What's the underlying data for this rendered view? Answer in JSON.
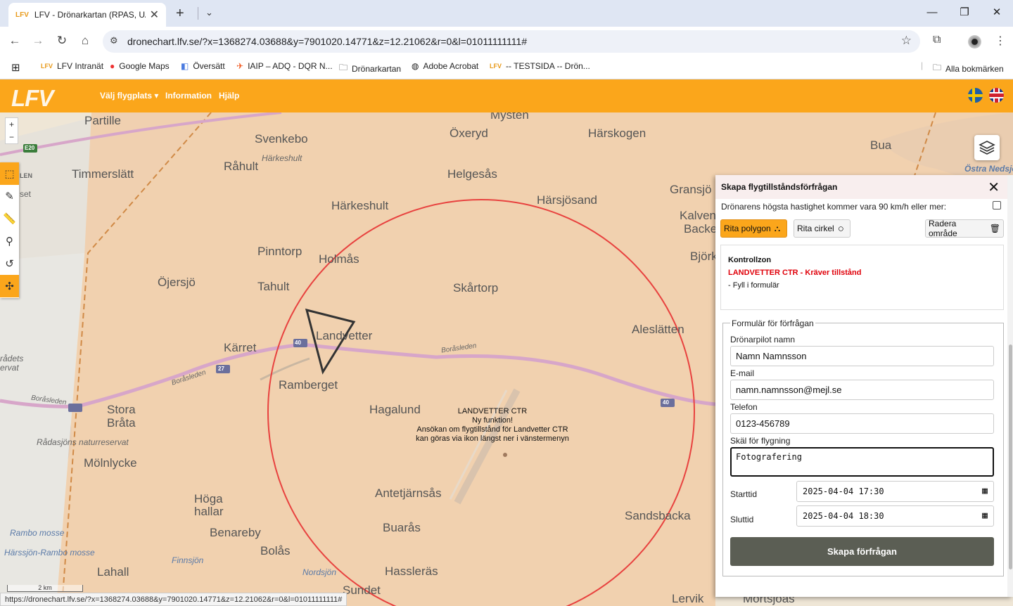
{
  "browser": {
    "tab_title": "LFV - Drönarkartan (RPAS, UAS,",
    "tab_favicon": "LFV",
    "new_tab": "+",
    "url": "dronechart.lfv.se/?x=1368274.03688&y=7901020.14771&z=12.21062&r=0&l=01011111111#",
    "bookmarks": [
      {
        "icon": "LFV",
        "label": "LFV Intranät"
      },
      {
        "icon": "map-pin-icon",
        "label": "Google Maps"
      },
      {
        "icon": "translate-icon",
        "label": "Översätt"
      },
      {
        "icon": "plane-icon",
        "label": "IAIP – ADQ - DQR N..."
      },
      {
        "icon": "folder-icon",
        "label": "Drönarkartan"
      },
      {
        "icon": "globe-icon",
        "label": "Adobe Acrobat"
      },
      {
        "icon": "LFV",
        "label": "-- TESTSIDA -- Drön..."
      }
    ],
    "all_bookmarks": "Alla bokmärken",
    "status_url": "https://dronechart.lfv.se/?x=1368274.03688&y=7901020.14771&z=12.21062&r=0&l=01011111111#"
  },
  "header": {
    "logo": "LFV",
    "menu": [
      "Välj flygplats ▾",
      "Information",
      "Hjälp"
    ]
  },
  "map": {
    "places": [
      "Mysten",
      "Partille",
      "Svenkebo",
      "Öxeryd",
      "Härskogen",
      "Bua",
      "Härkeshult",
      "Råhult",
      "Timmerslätt",
      "Helgesås",
      "Gransjö",
      "Härkeshult",
      "Härsjösand",
      "Kalven",
      "Backe",
      "Pinntorp",
      "Holmås",
      "Björk",
      "Öjersjö",
      "Tahult",
      "Skårtorp",
      "Landvetter",
      "Aleslätten",
      "Kärret",
      "Ramberget",
      "Hagalund",
      "Stora",
      "Bråta",
      "Mölnlycke",
      "Antetjärnsås",
      "Höga",
      "hallar",
      "Benareby",
      "Buarås",
      "Sandsbacka",
      "Bolås",
      "Lahall",
      "Hassleräs",
      "Sundet",
      "Lervik",
      "Mortsjöås",
      "Östra Nedsjö"
    ],
    "small_places": [
      "Rådasjöns naturreservat",
      "Rambo mosse",
      "Härssjön-Rambo mosse",
      "Finnsjön",
      "Nordsjön",
      "LEN",
      "set",
      "rådets",
      "ervat"
    ],
    "roads": [
      "E20",
      "40",
      "27",
      "40",
      "Boråsleden",
      "Boråsleden",
      "Boråsleden"
    ],
    "ctr_note": [
      "LANDVETTER CTR",
      "Ny funktion!",
      "Ansökan om flygtillstånd för Landvetter CTR",
      "kan göras via ikon längst ner i vänstermenyn"
    ],
    "zoom_in": "+",
    "zoom_out": "−",
    "scale": "2 km",
    "colors": {
      "ctr_fill": "#f3c9a0",
      "ctr_line": "#e8423f",
      "header": "#fba61b"
    }
  },
  "panel": {
    "title": "Skapa flygtillståndsförfrågan",
    "speed_question": "Drönarens högsta hastighet kommer vara 90 km/h eller mer:",
    "speed_checked": false,
    "btn_polygon": "Rita polygon",
    "btn_circle": "Rita cirkel",
    "btn_delete": "Radera område",
    "zone_title": "Kontrollzon",
    "zone_name": "LANDVETTER CTR - Kräver tillstånd",
    "zone_action": "- Fyll i formulär",
    "form_legend": "Formulär för förfrågan",
    "pilot_label": "Drönarpilot namn",
    "pilot_value": "Namn Namnsson",
    "email_label": "E-mail",
    "email_value": "namn.namnsson@mejl.se",
    "phone_label": "Telefon",
    "phone_value": "0123-456789",
    "reason_label": "Skäl för flygning",
    "reason_value": "Fotografering",
    "start_label": "Starttid",
    "start_value": "2025-04-04  17:30",
    "end_label": "Sluttid",
    "end_value": "2025-04-04  18:30",
    "submit": "Skapa förfrågan"
  }
}
